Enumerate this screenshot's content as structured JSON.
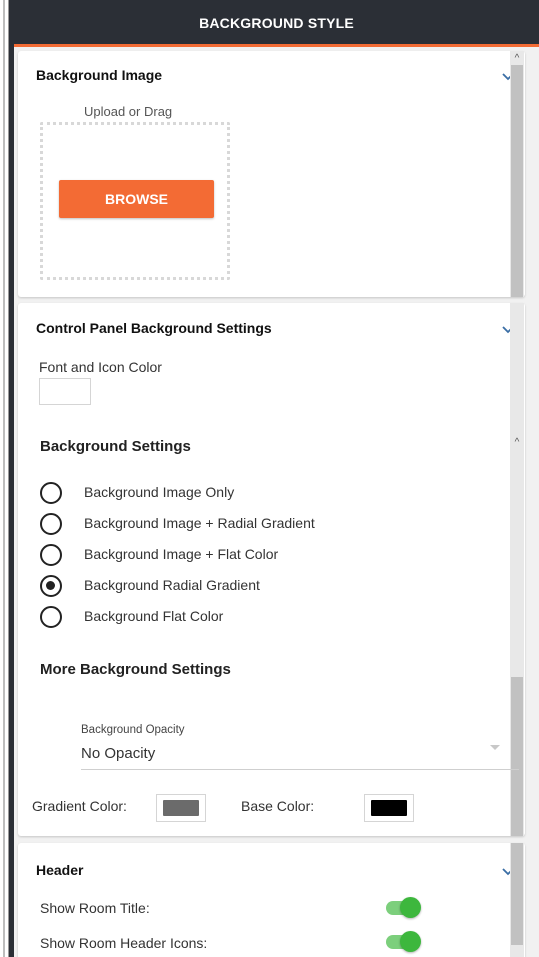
{
  "header": {
    "title": "BACKGROUND STYLE"
  },
  "background_image": {
    "title": "Background Image",
    "upload_label": "Upload or Drag",
    "browse_label": "BROWSE"
  },
  "control_panel": {
    "title": "Control Panel Background Settings",
    "font_icon_color_label": "Font and Icon Color",
    "font_icon_color": "#ffffff",
    "background_settings_heading": "Background Settings",
    "options": [
      {
        "label": "Background Image Only",
        "selected": false
      },
      {
        "label": "Background Image + Radial Gradient",
        "selected": false
      },
      {
        "label": "Background Image + Flat Color",
        "selected": false
      },
      {
        "label": "Background Radial Gradient",
        "selected": true
      },
      {
        "label": "Background Flat Color",
        "selected": false
      }
    ],
    "more_settings_heading": "More Background Settings",
    "opacity_label": "Background Opacity",
    "opacity_value": "No Opacity",
    "gradient_color_label": "Gradient Color:",
    "gradient_color": "#6b6b6b",
    "base_color_label": "Base Color:",
    "base_color": "#000000"
  },
  "header_section": {
    "title": "Header",
    "show_room_title_label": "Show Room Title:",
    "show_room_title_enabled": true,
    "show_room_header_icons_label": "Show Room Header Icons:",
    "show_room_header_icons_enabled": true
  },
  "colors": {
    "accent": "#f36b34",
    "topbar": "#2b2f36",
    "toggle_on": "#3db73d"
  }
}
